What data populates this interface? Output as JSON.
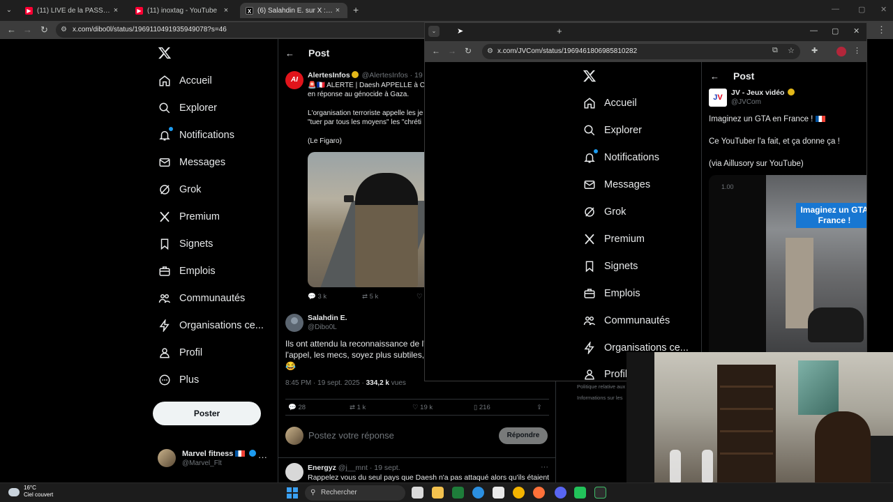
{
  "browser": {
    "tabs": [
      {
        "title": "(11) LIVE de la PASSION - YouT"
      },
      {
        "title": "(11) inoxtag - YouTube"
      },
      {
        "title": "(6) Salahdin E. sur X : \"@Alerte"
      }
    ],
    "url": "x.com/dibo0l/status/1969110491935949078?s=46"
  },
  "x_nav": {
    "items": [
      {
        "label": "Accueil"
      },
      {
        "label": "Explorer"
      },
      {
        "label": "Notifications"
      },
      {
        "label": "Messages"
      },
      {
        "label": "Grok"
      },
      {
        "label": "Premium"
      },
      {
        "label": "Signets"
      },
      {
        "label": "Emplois"
      },
      {
        "label": "Communautés"
      },
      {
        "label": "Organisations ce..."
      },
      {
        "label": "Profil"
      },
      {
        "label": "Plus"
      }
    ],
    "post_button": "Poster",
    "account": {
      "name": "Marvel fitness",
      "handle": "@Marvel_Flt"
    }
  },
  "post": {
    "header": "Post",
    "quoted": {
      "avatar_text": "AI",
      "name": "AlertesInfos",
      "handle_time": "@AlertesInfos · 19 s",
      "line1": "🚨🇫🇷 ALERTE | Daesh APPELLE à CO",
      "line2": "en réponse au génocide à Gaza.",
      "line3": "L'organisation terroriste appelle les je",
      "line4": "\"tuer par tous les moyens\" les \"chréti",
      "line5": "(Le Figaro)",
      "replies": "3 k",
      "reposts": "5 k"
    },
    "reply": {
      "name": "Salahdin E.",
      "handle": "@Dibo0L",
      "line1": "Ils ont attendu la reconnaissance de l'É",
      "line2": "l'appel, les mecs, soyez plus subtiles, q",
      "line3": "😂",
      "time": "8:45 PM · 19 sept. 2025 · ",
      "views": "334,2 k",
      "views_label": " vues",
      "replies": "28",
      "reposts": "1 k",
      "likes": "19 k",
      "bookmarks": "216"
    },
    "reply_placeholder": "Postez votre réponse",
    "reply_button": "Répondre",
    "next": {
      "name": "Energyz",
      "handle_time": "@j__mnt · 19 sept.",
      "text": "Rappelez vous du seul pays que Daesh n'a pas attaqué alors qu'ils étaient"
    }
  },
  "right_footer": {
    "line1": "Politique relative aux",
    "line2": "Informations sur les"
  },
  "popup": {
    "url": "x.com/JVCom/status/1969461806985810282",
    "nav": [
      {
        "label": "Accueil"
      },
      {
        "label": "Explorer"
      },
      {
        "label": "Notifications"
      },
      {
        "label": "Messages"
      },
      {
        "label": "Grok"
      },
      {
        "label": "Premium"
      },
      {
        "label": "Signets"
      },
      {
        "label": "Emplois"
      },
      {
        "label": "Communautés"
      },
      {
        "label": "Organisations ce..."
      },
      {
        "label": "Profil"
      }
    ],
    "header": "Post",
    "author": {
      "avatar_j": "J",
      "avatar_v": "V",
      "name": "JV - Jeux vidéo",
      "handle": "@JVCom"
    },
    "text1": "Imaginez un GTA en France ! ",
    "text2": "Ce YouTuber l'a fait, et ça donne ça !",
    "text3": "(via Aillusory sur YouTube)",
    "video_rate": "1.00",
    "video_caption1": "Imaginez un GTA",
    "video_caption2": "France !"
  },
  "taskbar": {
    "temp": "16°C",
    "weather": "Ciel couvert",
    "search": "Rechercher"
  }
}
